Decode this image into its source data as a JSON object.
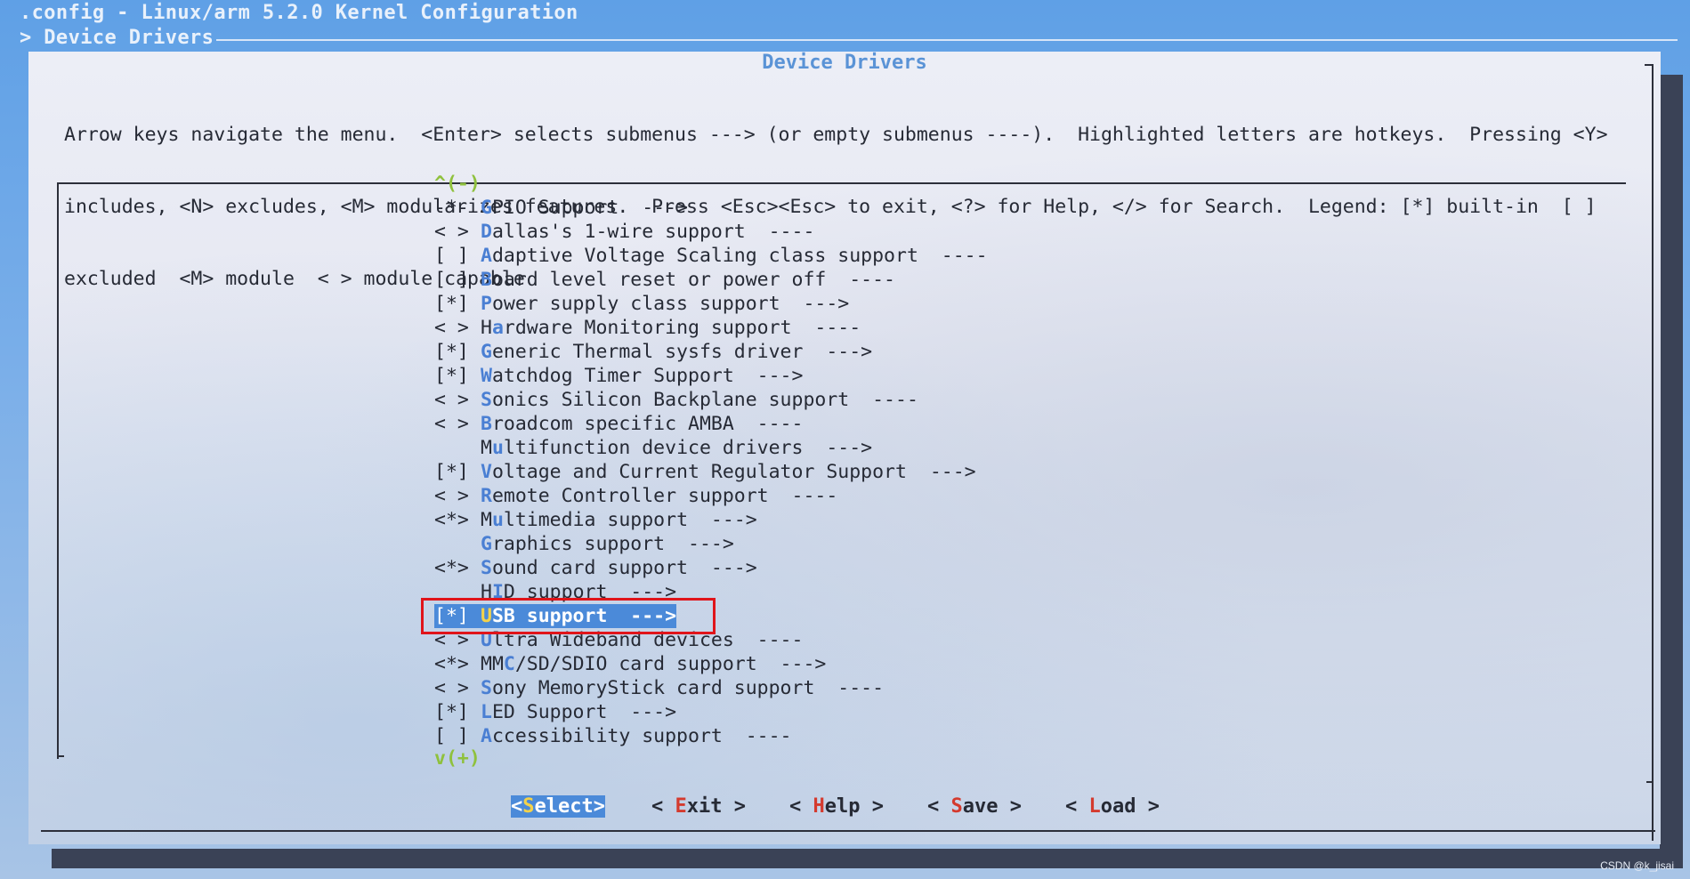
{
  "window": {
    "title": ".config - Linux/arm 5.2.0 Kernel Configuration",
    "path": "> Device Drivers"
  },
  "dialog": {
    "title": "Device Drivers",
    "help_lines": [
      "Arrow keys navigate the menu.  <Enter> selects submenus ---> (or empty submenus ----).  Highlighted letters are hotkeys.  Pressing <Y>",
      "includes, <N> excludes, <M> modularizes features.  Press <Esc><Esc> to exit, <?> for Help, </> for Search.  Legend: [*] built-in  [ ]",
      "excluded  <M> module  < > module capable"
    ],
    "scroll_up": "^(-)",
    "scroll_down": "v(+)"
  },
  "menu": [
    {
      "prefix": "-*-",
      "pre": "",
      "hotkey": "G",
      "rest": "PIO Support  --->",
      "selected": false
    },
    {
      "prefix": "< >",
      "pre": "",
      "hotkey": "D",
      "rest": "allas's 1-wire support  ----",
      "selected": false
    },
    {
      "prefix": "[ ]",
      "pre": "",
      "hotkey": "A",
      "rest": "daptive Voltage Scaling class support  ----",
      "selected": false
    },
    {
      "prefix": "[ ]",
      "pre": "",
      "hotkey": "B",
      "rest": "oard level reset or power off  ----",
      "selected": false
    },
    {
      "prefix": "[*]",
      "pre": "",
      "hotkey": "P",
      "rest": "ower supply class support  --->",
      "selected": false
    },
    {
      "prefix": "< >",
      "pre": "H",
      "hotkey": "a",
      "rest": "rdware Monitoring support  ----",
      "selected": false
    },
    {
      "prefix": "[*]",
      "pre": "",
      "hotkey": "G",
      "rest": "eneric Thermal sysfs driver  --->",
      "selected": false
    },
    {
      "prefix": "[*]",
      "pre": "",
      "hotkey": "W",
      "rest": "atchdog Timer Support  --->",
      "selected": false
    },
    {
      "prefix": "< >",
      "pre": "",
      "hotkey": "S",
      "rest": "onics Silicon Backplane support  ----",
      "selected": false
    },
    {
      "prefix": "< >",
      "pre": "",
      "hotkey": "B",
      "rest": "roadcom specific AMBA  ----",
      "selected": false
    },
    {
      "prefix": "   ",
      "pre": "M",
      "hotkey": "u",
      "rest": "ltifunction device drivers  --->",
      "selected": false
    },
    {
      "prefix": "[*]",
      "pre": "",
      "hotkey": "V",
      "rest": "oltage and Current Regulator Support  --->",
      "selected": false
    },
    {
      "prefix": "< >",
      "pre": "",
      "hotkey": "R",
      "rest": "emote Controller support  ----",
      "selected": false
    },
    {
      "prefix": "<*>",
      "pre": "M",
      "hotkey": "u",
      "rest": "ltimedia support  --->",
      "selected": false
    },
    {
      "prefix": "   ",
      "pre": "",
      "hotkey": "G",
      "rest": "raphics support  --->",
      "selected": false
    },
    {
      "prefix": "<*>",
      "pre": "",
      "hotkey": "S",
      "rest": "ound card support  --->",
      "selected": false
    },
    {
      "prefix": "   ",
      "pre": "H",
      "hotkey": "I",
      "rest": "D support  --->",
      "selected": false
    },
    {
      "prefix": "[*]",
      "pre": "",
      "hotkey": "U",
      "rest": "SB support  --->",
      "selected": true
    },
    {
      "prefix": "< >",
      "pre": "",
      "hotkey": "U",
      "rest": "ltra Wideband devices  ----",
      "selected": false
    },
    {
      "prefix": "<*>",
      "pre": "MM",
      "hotkey": "C",
      "rest": "/SD/SDIO card support  --->",
      "selected": false
    },
    {
      "prefix": "< >",
      "pre": "",
      "hotkey": "S",
      "rest": "ony MemoryStick card support  ----",
      "selected": false
    },
    {
      "prefix": "[*]",
      "pre": "",
      "hotkey": "L",
      "rest": "ED Support  --->",
      "selected": false
    },
    {
      "prefix": "[ ]",
      "pre": "",
      "hotkey": "A",
      "rest": "ccessibility support  ----",
      "selected": false
    }
  ],
  "buttons": [
    {
      "left": "<",
      "hotkey": "S",
      "rest": "elect",
      "right": ">",
      "active": true
    },
    {
      "left": "< ",
      "hotkey": "E",
      "rest": "xit",
      "right": " >",
      "active": false
    },
    {
      "left": "< ",
      "hotkey": "H",
      "rest": "elp",
      "right": " >",
      "active": false
    },
    {
      "left": "< ",
      "hotkey": "S",
      "rest": "ave",
      "right": " >",
      "active": false
    },
    {
      "left": "< ",
      "hotkey": "L",
      "rest": "oad",
      "right": " >",
      "active": false
    }
  ],
  "watermark": "CSDN @k_jisai",
  "colors": {
    "hotkey": "#4a7fd3",
    "button_hotkey": "#d43a2e",
    "selection": "#4b8ad9",
    "selection_hotkey": "#f4d24a",
    "scroll_indicator": "#8fc13d",
    "annotation_box": "#e0141a"
  }
}
